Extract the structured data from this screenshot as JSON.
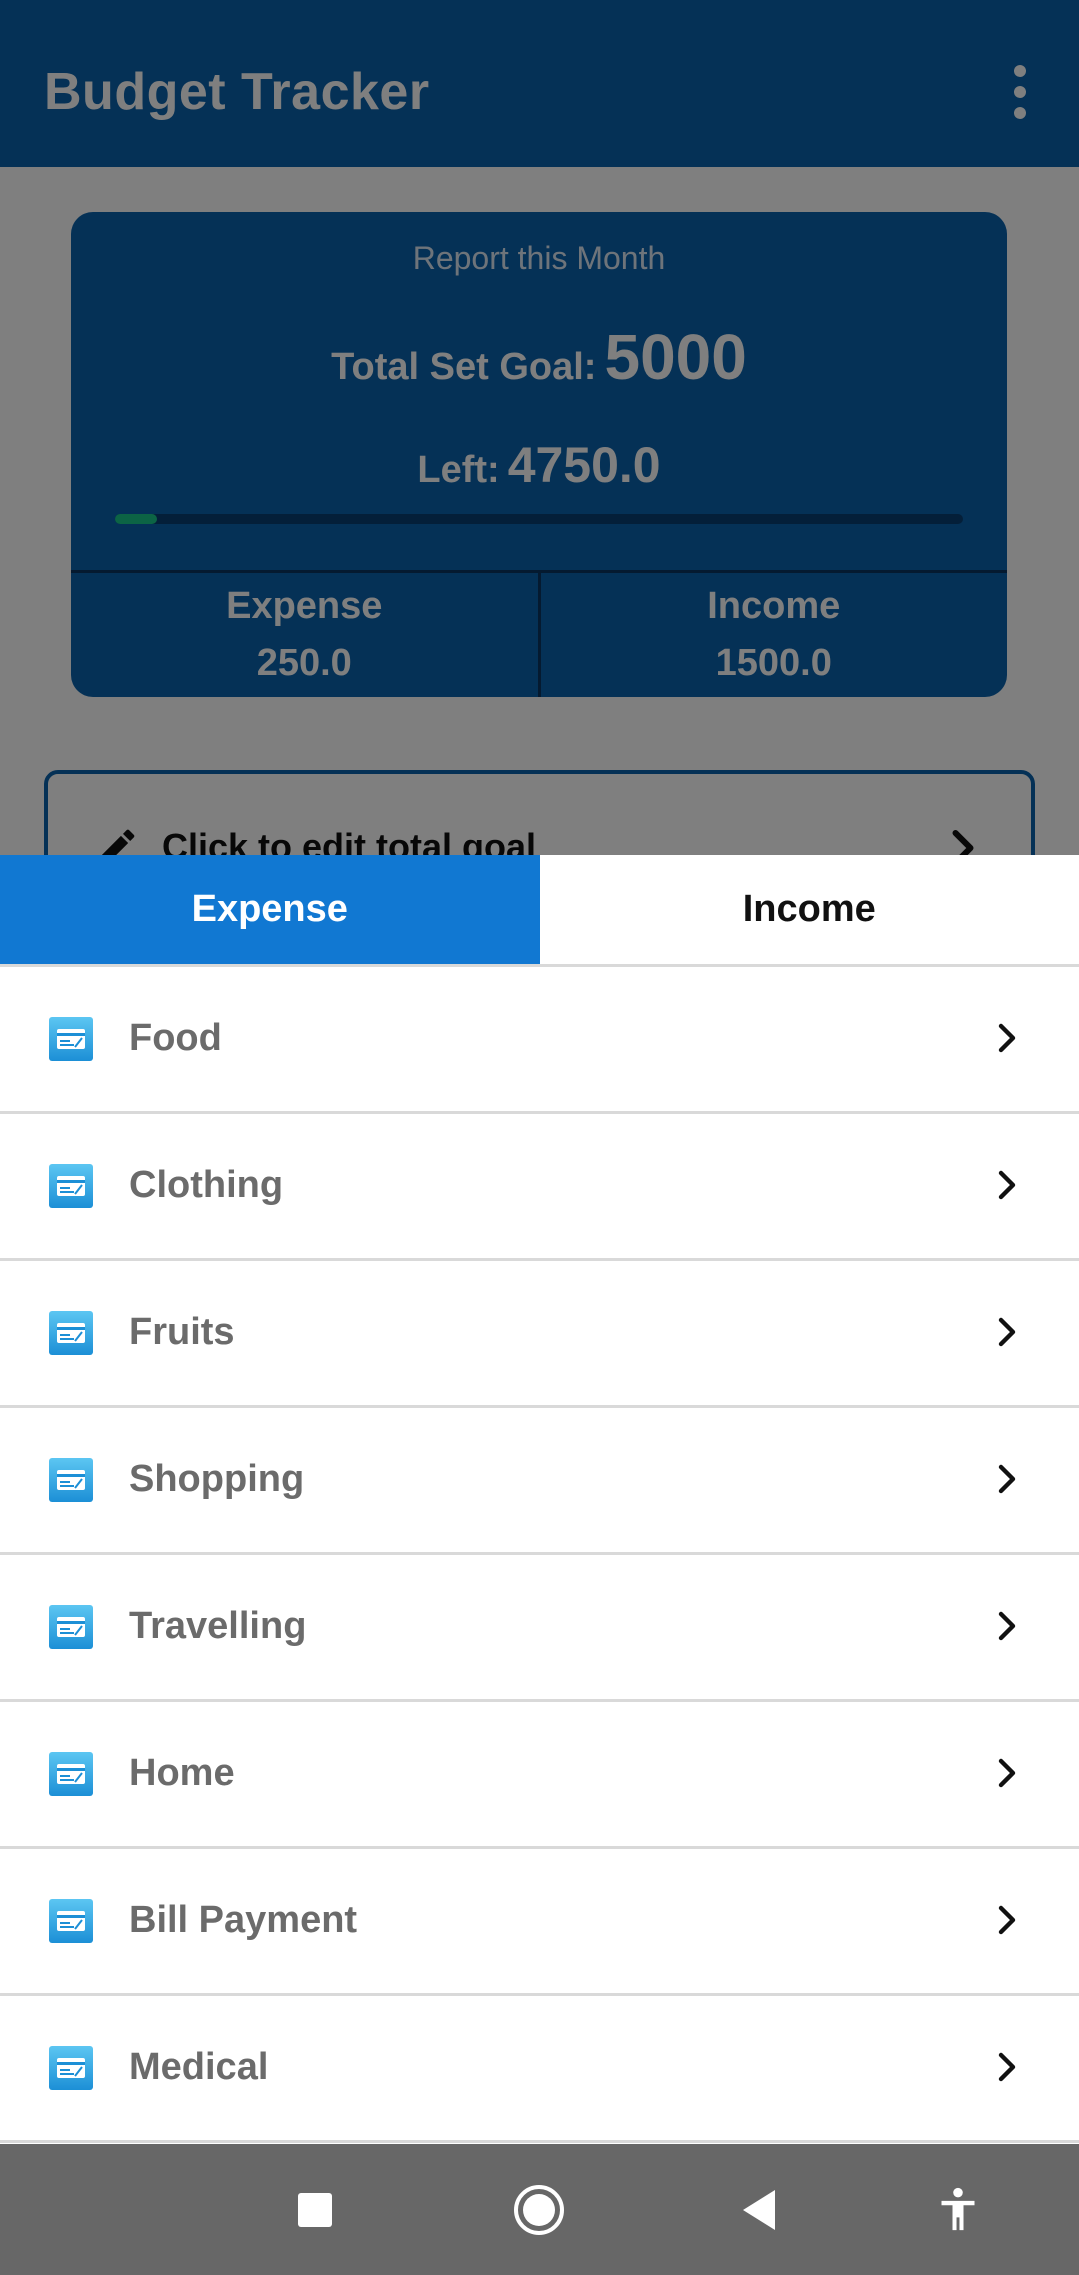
{
  "app": {
    "title": "Budget Tracker",
    "overflow_icon": "more-vert-icon"
  },
  "report_card": {
    "subtitle": "Report this Month",
    "goal_label": "Total Set Goal:",
    "goal_value": "5000",
    "left_label": "Left:",
    "left_value": "4750.0",
    "progress_fraction": 0.05,
    "expense_label": "Expense",
    "expense_value": "250.0",
    "income_label": "Income",
    "income_value": "1500.0"
  },
  "edit_goal": {
    "label": "Click to edit total goal",
    "icon": "pencil-icon"
  },
  "sheet": {
    "tabs": [
      {
        "label": "Expense",
        "active": true
      },
      {
        "label": "Income",
        "active": false
      }
    ],
    "categories": [
      {
        "label": "Food",
        "icon": "card-icon"
      },
      {
        "label": "Clothing",
        "icon": "card-icon"
      },
      {
        "label": "Fruits",
        "icon": "card-icon"
      },
      {
        "label": "Shopping",
        "icon": "card-icon"
      },
      {
        "label": "Travelling",
        "icon": "card-icon"
      },
      {
        "label": "Home",
        "icon": "card-icon"
      },
      {
        "label": "Bill Payment",
        "icon": "card-icon"
      },
      {
        "label": "Medical",
        "icon": "card-icon"
      }
    ]
  },
  "navbar": {
    "buttons": [
      "recents-icon",
      "home-icon",
      "back-icon",
      "accessibility-icon"
    ]
  },
  "colors": {
    "primary": "#0a62ad",
    "tab_active": "#1178d2",
    "progress": "#18c98a",
    "navbar": "#676767"
  }
}
